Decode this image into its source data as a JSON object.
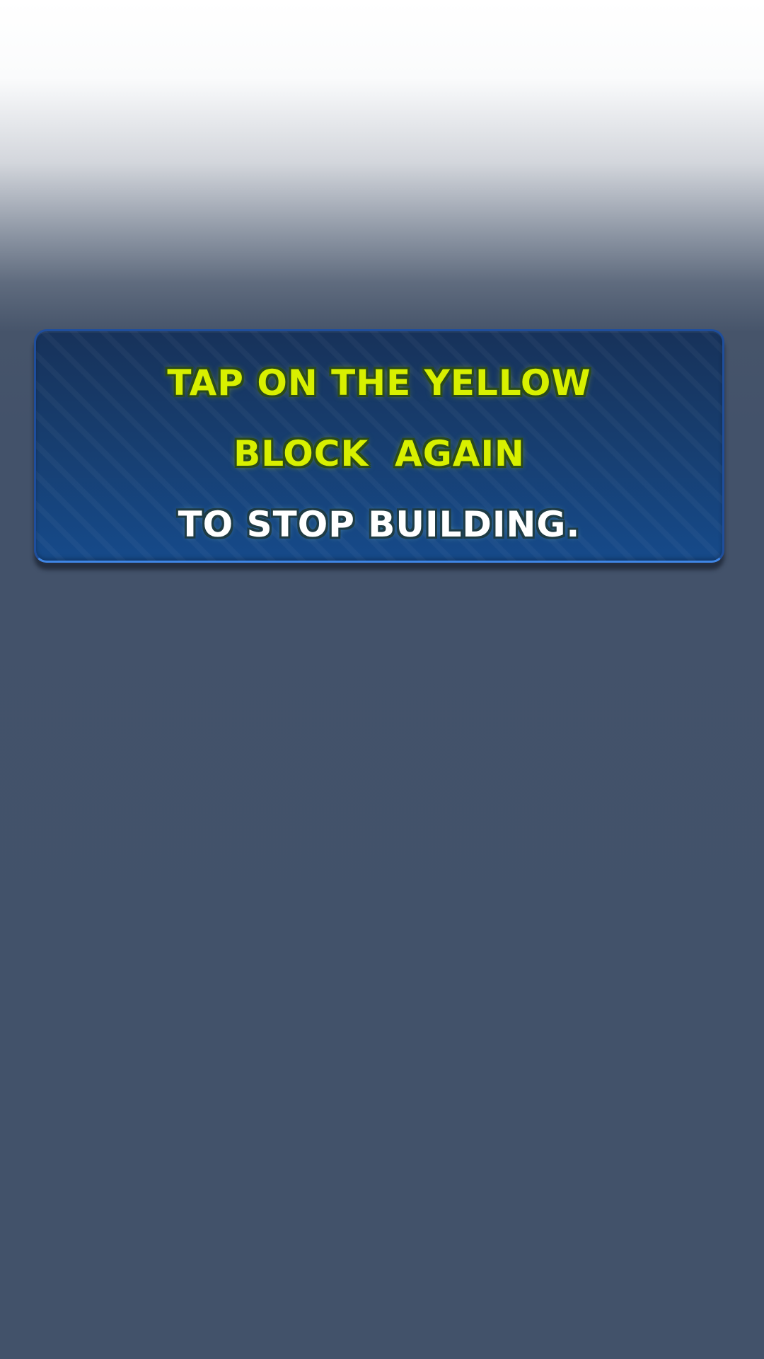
{
  "tutorial": {
    "line1": "TAP ON THE YELLOW",
    "line2": "BLOCK  AGAIN",
    "line3": "TO STOP BUILDING."
  },
  "colors": {
    "highlight_text": "#d8f000",
    "normal_text": "#ffffff",
    "panel": "#173e70",
    "background": "#42526a"
  }
}
